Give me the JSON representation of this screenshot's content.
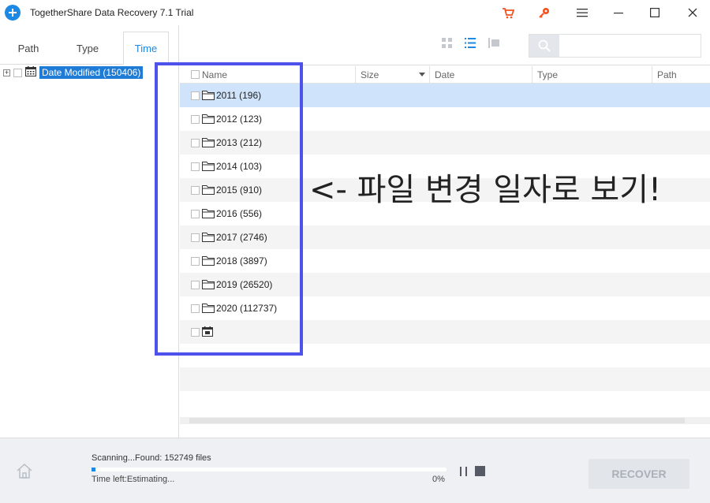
{
  "window": {
    "title": "TogetherShare Data Recovery 7.1 Trial",
    "colors": {
      "accent": "#1e88e5",
      "cart": "#f4511e",
      "key": "#f4511e",
      "annotation": "#4d52ea"
    },
    "icons": [
      "cart-icon",
      "key-icon",
      "menu-icon",
      "minimize-icon",
      "maximize-icon",
      "close-icon"
    ]
  },
  "tabs": [
    {
      "label": "Path"
    },
    {
      "label": "Type"
    },
    {
      "label": "Time",
      "active": true
    }
  ],
  "tree": {
    "root_label": "Date Modified (150406)",
    "expander": "+"
  },
  "list": {
    "columns": [
      "Name",
      "Size",
      "Date",
      "Type",
      "Path"
    ],
    "rows": [
      {
        "label": "2011 (196)",
        "selected": true
      },
      {
        "label": "2012 (123)"
      },
      {
        "label": "2013 (212)"
      },
      {
        "label": "2014 (103)"
      },
      {
        "label": "2015 (910)"
      },
      {
        "label": "2016 (556)"
      },
      {
        "label": "2017 (2746)"
      },
      {
        "label": "2018 (3897)"
      },
      {
        "label": "2019 (26520)"
      },
      {
        "label": "2020 (112737)"
      },
      {
        "label": "",
        "icon": "calendar-icon"
      }
    ]
  },
  "annotation": {
    "text": "<- 파일 변경 일자로 보기!"
  },
  "footer": {
    "scan_status": "Scanning...Found: 152749 files",
    "time_left": "Time left:Estimating...",
    "percent": "0%",
    "progress": 0.01,
    "recover_label": "RECOVER"
  }
}
